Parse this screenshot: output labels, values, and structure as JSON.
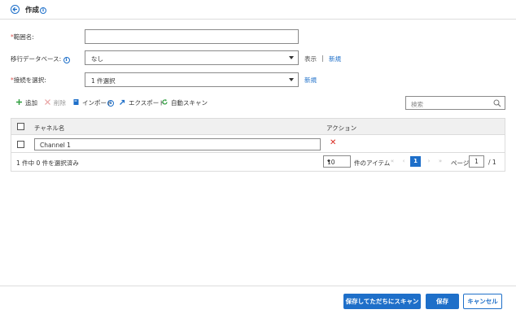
{
  "header": {
    "title": "作成"
  },
  "form": {
    "range_name": {
      "label": "範囲名:",
      "value": ""
    },
    "migration_db": {
      "label": "移行データベース:",
      "value": "なし",
      "view_link": "表示",
      "separator": "|",
      "new_link": "新規"
    },
    "connection": {
      "label": "接続を選択:",
      "value": "1 件選択",
      "new_link": "新規"
    }
  },
  "toolbar": {
    "add": "追加",
    "delete": "削除",
    "import": "インポート",
    "export": "エクスポート",
    "auto_scan": "自動スキャン",
    "search_placeholder": "検索"
  },
  "table": {
    "columns": {
      "channel_name": "チャネル名",
      "action": "アクション"
    },
    "rows": [
      {
        "channel_name": "Channel 1"
      }
    ],
    "selection_status": "1 件中 0 件を選択済み",
    "page_size": "10",
    "items_label": "件のアイテム",
    "current_page": "1",
    "page_label": "ページ",
    "page_input": "1",
    "total_pages": "/ 1"
  },
  "buttons": {
    "save_and_scan": "保存してただちにスキャン",
    "save": "保存",
    "cancel": "キャンセル"
  },
  "colors": {
    "accent": "#1e6fc9",
    "required": "#d9534f",
    "delete": "#d9281e",
    "add": "#2e9e3e"
  }
}
